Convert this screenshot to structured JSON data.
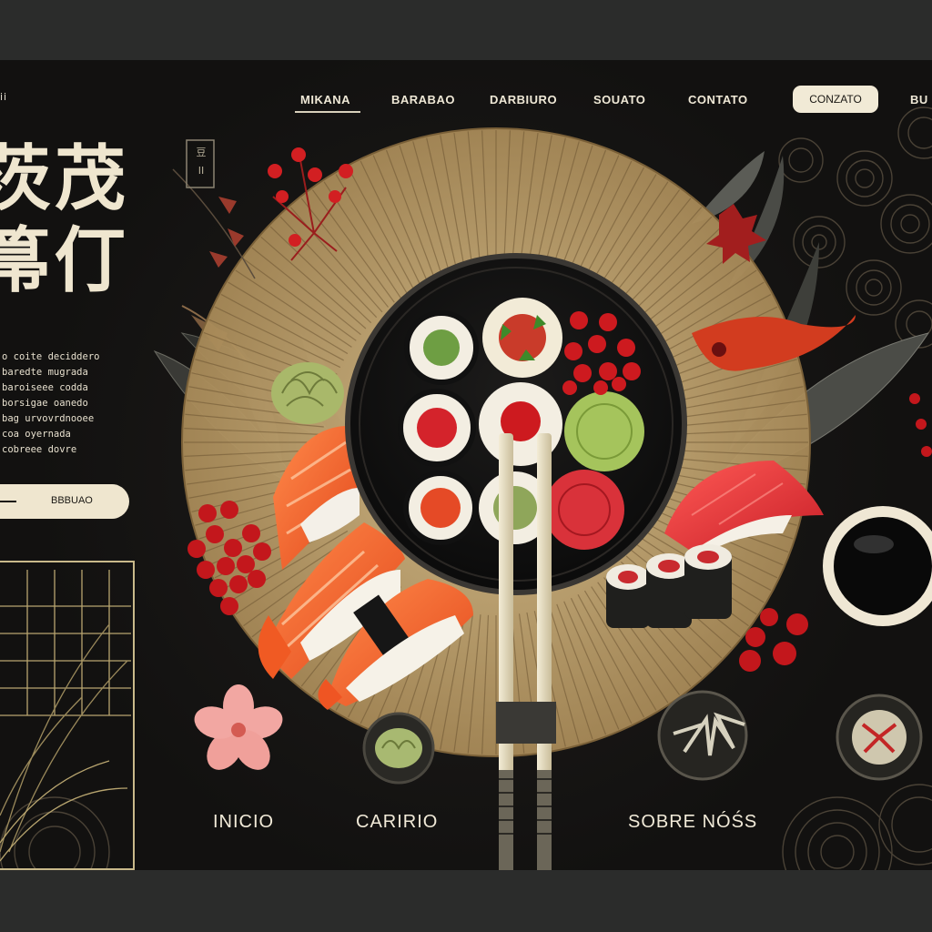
{
  "brand": {
    "mark": "ii"
  },
  "nav": {
    "items": [
      "MIKANA",
      "BARABAO",
      "DARBIURO",
      "SOUATO",
      "CONTATO",
      "BU"
    ],
    "cta": "CONZATO"
  },
  "hero": {
    "title_line1": "茨茂",
    "title_line2": "箒仃",
    "side_text": "o coite deciddero\nbaredte mugrada\nbaroiseee codda\nborsigae oanedo\nbag urvovrdnooee\ncoa oyernada\ncobreee dovre",
    "button_label": "BBBUAO"
  },
  "stamp": {
    "text_top": "豆",
    "text_bottom": "II"
  },
  "bottom_nav": {
    "inicio": "INICIO",
    "cardapio": "CARIRIO",
    "sobre": "SOBRE NÓŚS"
  },
  "colors": {
    "background": "#131211",
    "cream": "#efe6cf",
    "gold": "#c9b98a",
    "salmon": "#f0642a",
    "tuna": "#e4313a",
    "berry": "#c3171c",
    "wasabi": "#9fc15e"
  },
  "icons": [
    "sakura-flower-icon",
    "chopsticks-icon",
    "soy-sauce-bowl-icon",
    "wasabi-bowl-icon"
  ]
}
